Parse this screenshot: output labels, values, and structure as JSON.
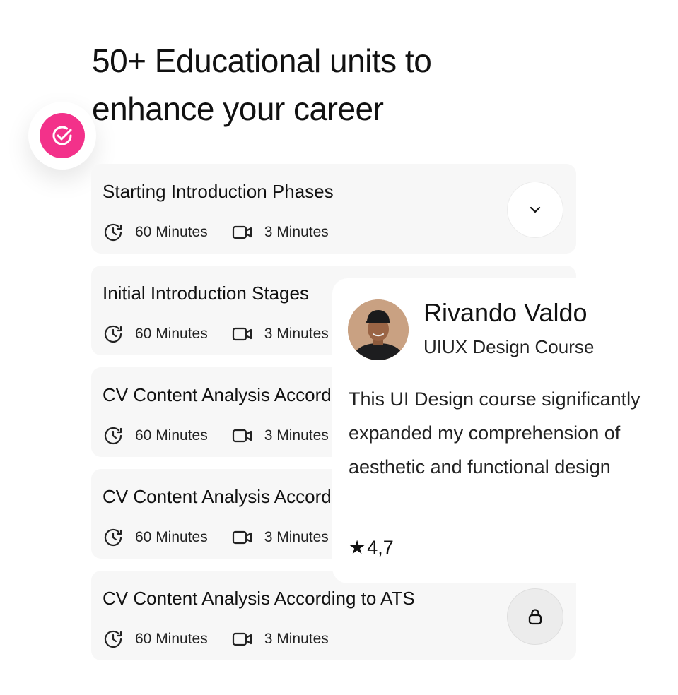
{
  "headline": "50+ Educational units to enhance your career",
  "units": [
    {
      "title": "Starting Introduction Phases",
      "duration": "60 Minutes",
      "video": "3 Minutes",
      "action": "chevron-down-icon"
    },
    {
      "title": "Initial Introduction Stages",
      "duration": "60 Minutes",
      "video": "3 Minutes"
    },
    {
      "title": "CV Content Analysis According to ATS",
      "duration": "60 Minutes",
      "video": "3 Minutes"
    },
    {
      "title": "CV Content Analysis According to ATS",
      "duration": "60 Minutes",
      "video": "3 Minutes"
    },
    {
      "title": "CV Content Analysis According to ATS",
      "duration": "60 Minutes",
      "video": "3 Minutes",
      "action": "lock-icon"
    }
  ],
  "review": {
    "name": "Rivando Valdo",
    "course": "UIUX Design Course",
    "text": "This UI Design course significantly expanded my comprehension of aesthetic and functional design",
    "rating": "4,7"
  },
  "colors": {
    "accent": "#f3318a",
    "card_bg": "#f7f7f7"
  }
}
